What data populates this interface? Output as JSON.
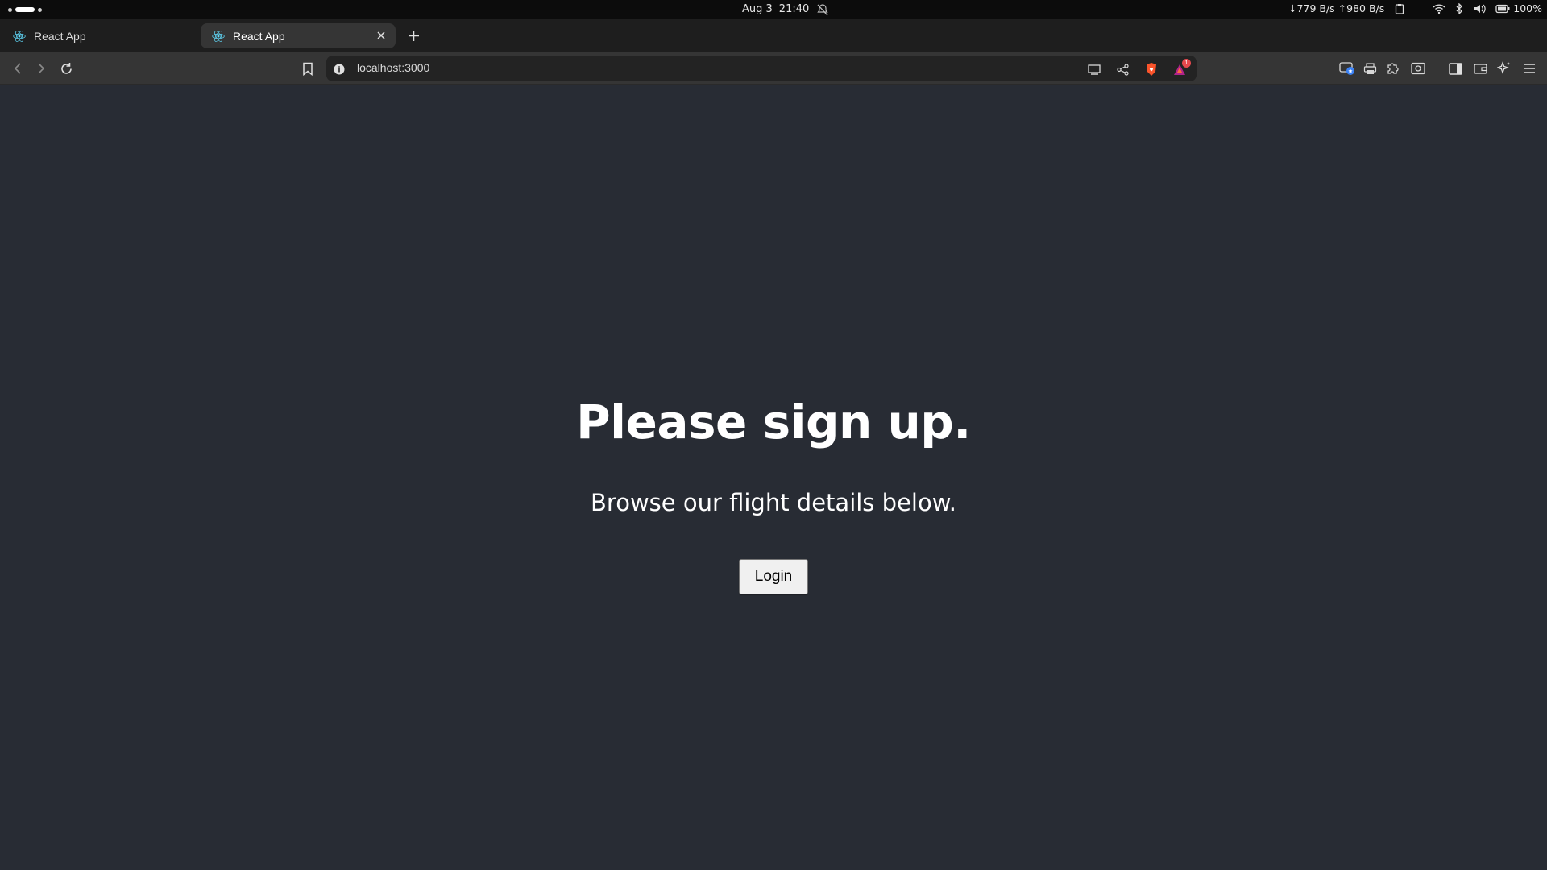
{
  "system_bar": {
    "date": "Aug 3",
    "time": "21:40",
    "network_speed": "↓779 B/s ↑980 B/s",
    "battery": "100%",
    "icons": [
      "notifications-off-icon",
      "clipboard-icon",
      "wifi-icon",
      "bluetooth-icon",
      "volume-icon",
      "battery-icon"
    ]
  },
  "browser": {
    "tabs": [
      {
        "title": "React App",
        "active": false,
        "favicon": "react-icon"
      },
      {
        "title": "React App",
        "active": true,
        "favicon": "react-icon"
      }
    ],
    "new_tab": "+",
    "url": "localhost:3000",
    "rewards_count": "1",
    "colors": {
      "tabstrip_bg": "#1e1e1e",
      "toolbar_bg": "#353535",
      "urlbar_bg": "#232323",
      "brave_orange": "#fb542b",
      "react_cyan": "#61dafb"
    }
  },
  "page": {
    "title": "Please sign up.",
    "subtitle": "Browse our flight details below.",
    "login_label": "Login",
    "background": "#282c34"
  }
}
